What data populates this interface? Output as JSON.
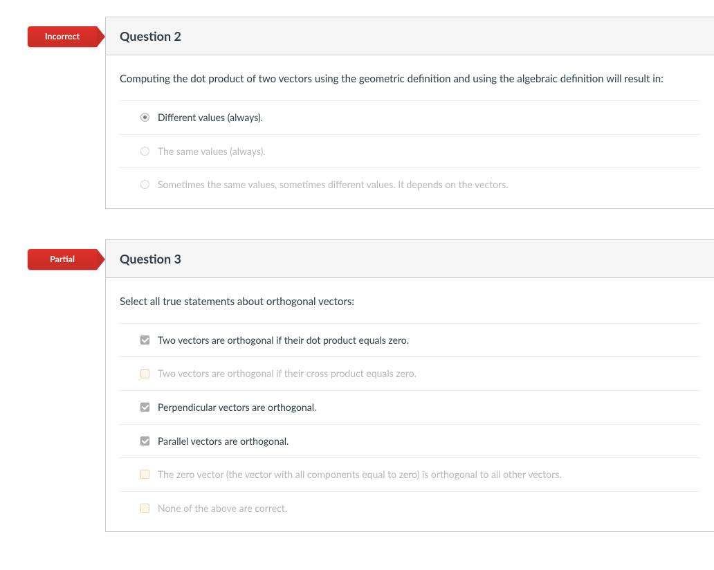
{
  "questions": [
    {
      "status": "Incorrect",
      "title": "Question 2",
      "prompt": "Computing the dot product of two vectors using the geometric definition and using the algebraic definition will result in:",
      "type": "radio",
      "answers": [
        {
          "text": "Different values (always).",
          "selected": true
        },
        {
          "text": "The same values (always).",
          "selected": false
        },
        {
          "text": "Sometimes the same values, sometimes different values.  It depends on the vectors.",
          "selected": false
        }
      ]
    },
    {
      "status": "Partial",
      "title": "Question 3",
      "prompt": "Select all true statements about orthogonal vectors:",
      "type": "checkbox",
      "answers": [
        {
          "text": "Two vectors are orthogonal if their dot product equals zero.",
          "selected": true
        },
        {
          "text": "Two vectors are orthogonal if their cross product equals zero.",
          "selected": false
        },
        {
          "text": "Perpendicular vectors are orthogonal.",
          "selected": true
        },
        {
          "text": "Parallel vectors are orthogonal.",
          "selected": true
        },
        {
          "text": "The zero vector (the vector with all components equal to zero) is orthogonal to all other vectors.",
          "selected": false
        },
        {
          "text": "None of the above are correct.",
          "selected": false
        }
      ]
    }
  ]
}
